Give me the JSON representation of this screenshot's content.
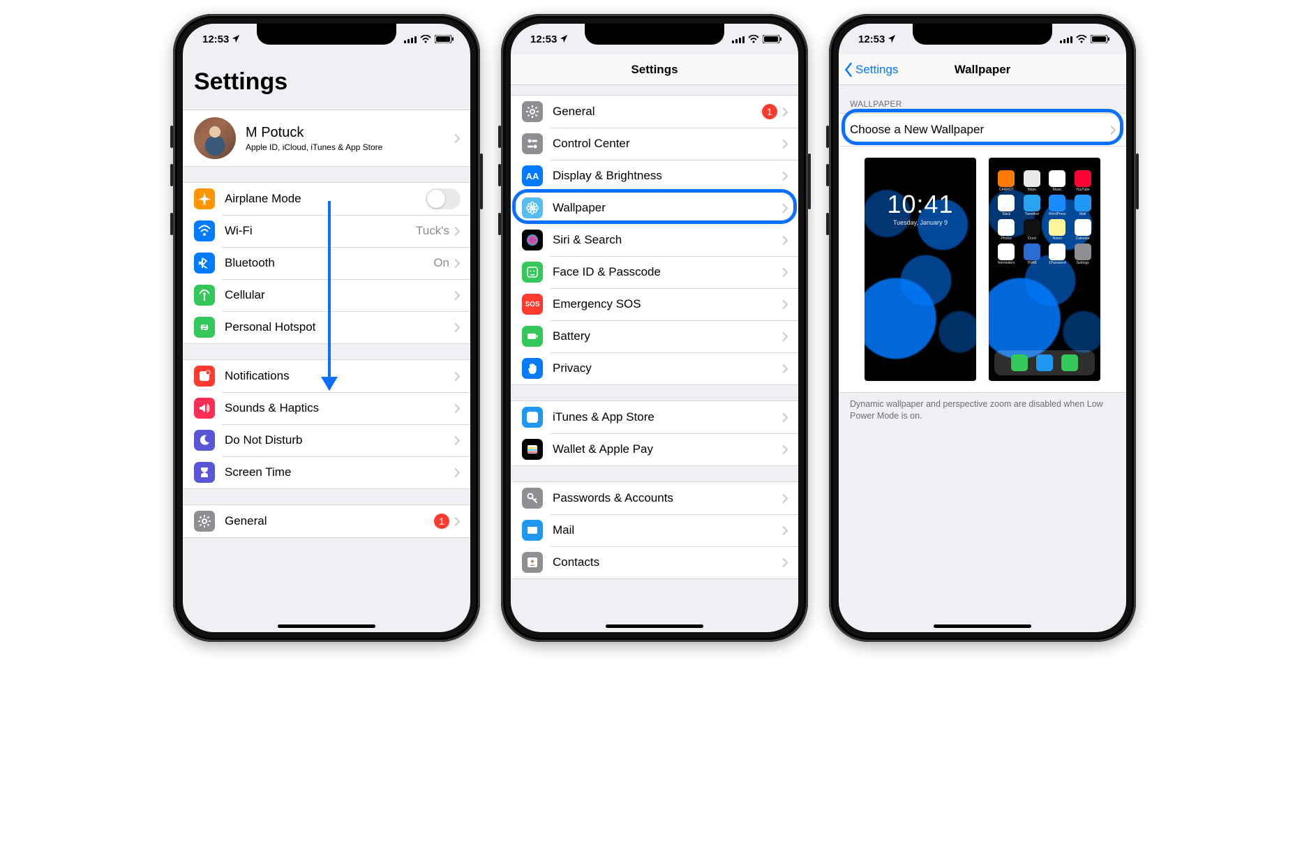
{
  "status": {
    "time": "12:53",
    "location_arrow": true
  },
  "screen1": {
    "title": "Settings",
    "profile": {
      "name": "M Potuck",
      "subtitle": "Apple ID, iCloud, iTunes & App Store"
    },
    "group_net": [
      {
        "label": "Airplane Mode",
        "icon": "airplane",
        "color": "#ff9500",
        "type": "toggle",
        "on": false
      },
      {
        "label": "Wi-Fi",
        "icon": "wifi",
        "color": "#007aff",
        "value": "Tuck's"
      },
      {
        "label": "Bluetooth",
        "icon": "bluetooth",
        "color": "#007aff",
        "value": "On"
      },
      {
        "label": "Cellular",
        "icon": "antenna",
        "color": "#34c759"
      },
      {
        "label": "Personal Hotspot",
        "icon": "link",
        "color": "#34c759"
      }
    ],
    "group_notif": [
      {
        "label": "Notifications",
        "icon": "notif",
        "color": "#ff3b30"
      },
      {
        "label": "Sounds & Haptics",
        "icon": "speaker",
        "color": "#ff2d55"
      },
      {
        "label": "Do Not Disturb",
        "icon": "moon",
        "color": "#5856d6"
      },
      {
        "label": "Screen Time",
        "icon": "hourglass",
        "color": "#5856d6"
      }
    ],
    "group_general_peek": [
      {
        "label": "General",
        "icon": "gear",
        "color": "#8e8e93",
        "badge": "1"
      }
    ]
  },
  "screen2": {
    "nav_title": "Settings",
    "group_a": [
      {
        "label": "General",
        "icon": "gear",
        "color": "#8e8e93",
        "badge": "1"
      },
      {
        "label": "Control Center",
        "icon": "switches",
        "color": "#8e8e93"
      },
      {
        "label": "Display & Brightness",
        "icon": "aa",
        "color": "#007aff"
      },
      {
        "label": "Wallpaper",
        "icon": "flower",
        "color": "#55bef0",
        "highlight": true
      },
      {
        "label": "Siri & Search",
        "icon": "siri",
        "color": "#000"
      },
      {
        "label": "Face ID & Passcode",
        "icon": "face",
        "color": "#34c759"
      },
      {
        "label": "Emergency SOS",
        "icon": "sos",
        "color": "#ff3b30",
        "text": "SOS"
      },
      {
        "label": "Battery",
        "icon": "battery",
        "color": "#34c759"
      },
      {
        "label": "Privacy",
        "icon": "hand",
        "color": "#007aff"
      }
    ],
    "group_b": [
      {
        "label": "iTunes & App Store",
        "icon": "appstore",
        "color": "#1f98f4"
      },
      {
        "label": "Wallet & Apple Pay",
        "icon": "wallet",
        "color": "#000"
      }
    ],
    "group_c": [
      {
        "label": "Passwords & Accounts",
        "icon": "key",
        "color": "#8e8e93"
      },
      {
        "label": "Mail",
        "icon": "envelope",
        "color": "#1f98f4"
      },
      {
        "label": "Contacts",
        "icon": "contacts",
        "color": "#8e8e93"
      }
    ]
  },
  "screen3": {
    "nav_back": "Settings",
    "nav_title": "Wallpaper",
    "section_header": "WALLPAPER",
    "choose_label": "Choose a New Wallpaper",
    "footer": "Dynamic wallpaper and perspective zoom are disabled when Low Power Mode is on.",
    "lock_preview": {
      "time": "10:41",
      "date": "Tuesday, January 9"
    },
    "home_apps": [
      {
        "lb": "CARROT",
        "c": "#ff7a00"
      },
      {
        "lb": "Maps",
        "c": "#e9e9e9"
      },
      {
        "lb": "Music",
        "c": "#ffffff"
      },
      {
        "lb": "YouTube",
        "c": "#ff0033"
      },
      {
        "lb": "Slack",
        "c": "#ffffff"
      },
      {
        "lb": "Tweetbot",
        "c": "#29a3ef"
      },
      {
        "lb": "WordPress",
        "c": "#1a8cff"
      },
      {
        "lb": "Mail",
        "c": "#1f98f4"
      },
      {
        "lb": "Photos",
        "c": "#ffffff"
      },
      {
        "lb": "Clock",
        "c": "#111"
      },
      {
        "lb": "Notes",
        "c": "#fff59a"
      },
      {
        "lb": "Calendar",
        "c": "#ffffff"
      },
      {
        "lb": "Reminders",
        "c": "#ffffff"
      },
      {
        "lb": "YNAB",
        "c": "#2a6bd4"
      },
      {
        "lb": "1Password",
        "c": "#ffffff"
      },
      {
        "lb": "Settings",
        "c": "#8e8e93"
      }
    ],
    "dock": [
      {
        "c": "#34c759"
      },
      {
        "c": "#1f98f4"
      },
      {
        "c": "#34c759"
      }
    ]
  }
}
